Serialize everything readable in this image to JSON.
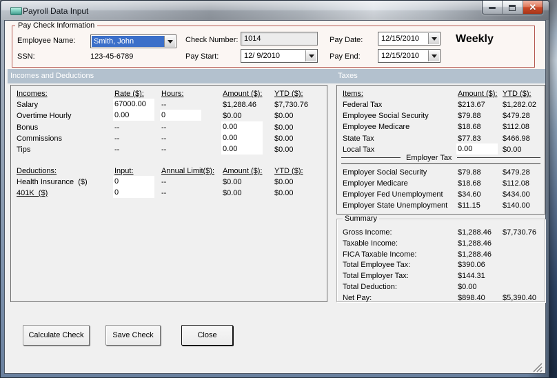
{
  "window": {
    "title": "Payroll Data Input",
    "icons": {
      "minimize": "minimize",
      "maximize": "maximize",
      "close_glyph": "✕",
      "app": "form-icon",
      "resize": "resize-grip"
    }
  },
  "paycheck": {
    "group_label": "Pay Check Information",
    "employee_name_label": "Employee Name:",
    "employee_name_value": "Smith, John",
    "ssn_label": "SSN:",
    "ssn_value": "123-45-6789",
    "check_number_label": "Check Number:",
    "check_number_value": "1014",
    "pay_start_label": "Pay Start:",
    "pay_start_value": "12/ 9/2010",
    "pay_date_label": "Pay Date:",
    "pay_date_value": "12/15/2010",
    "pay_end_label": "Pay End:",
    "pay_end_value": "12/15/2010",
    "frequency": "Weekly"
  },
  "sections": {
    "incomes": "Incomes and Deductions",
    "taxes": "Taxes"
  },
  "incomes_table": {
    "headers": [
      "Incomes:",
      "Rate ($):",
      "Hours:",
      "Amount ($):",
      "YTD ($):"
    ],
    "rows": [
      [
        {
          "t": "text",
          "v": "Salary"
        },
        {
          "t": "input",
          "v": "67000.00"
        },
        {
          "t": "text",
          "v": "--"
        },
        {
          "t": "text",
          "v": "$1,288.46"
        },
        {
          "t": "text",
          "v": "$7,730.76"
        }
      ],
      [
        {
          "t": "text",
          "v": "Overtime Hourly"
        },
        {
          "t": "input",
          "v": "0.00"
        },
        {
          "t": "input",
          "v": "0"
        },
        {
          "t": "text",
          "v": "$0.00"
        },
        {
          "t": "text",
          "v": "$0.00"
        }
      ],
      [
        {
          "t": "text",
          "v": "Bonus"
        },
        {
          "t": "text",
          "v": "--"
        },
        {
          "t": "text",
          "v": "--"
        },
        {
          "t": "input",
          "v": "0.00"
        },
        {
          "t": "text",
          "v": "$0.00"
        }
      ],
      [
        {
          "t": "text",
          "v": "Commissions"
        },
        {
          "t": "text",
          "v": "--"
        },
        {
          "t": "text",
          "v": "--"
        },
        {
          "t": "input",
          "v": "0.00"
        },
        {
          "t": "text",
          "v": "$0.00"
        }
      ],
      [
        {
          "t": "text",
          "v": "Tips"
        },
        {
          "t": "text",
          "v": "--"
        },
        {
          "t": "text",
          "v": "--"
        },
        {
          "t": "input",
          "v": "0.00"
        },
        {
          "t": "text",
          "v": "$0.00"
        }
      ]
    ]
  },
  "deductions_table": {
    "headers": [
      "Deductions:",
      "Input:",
      "Annual Limit($):",
      "Amount ($):",
      "YTD ($):"
    ],
    "rows": [
      [
        {
          "t": "text",
          "v": "Health Insurance  ($)"
        },
        {
          "t": "input",
          "v": "0"
        },
        {
          "t": "text",
          "v": "--"
        },
        {
          "t": "text",
          "v": "$0.00"
        },
        {
          "t": "text",
          "v": "$0.00"
        }
      ],
      [
        {
          "t": "link",
          "v": "401K  ($)"
        },
        {
          "t": "input",
          "v": "0"
        },
        {
          "t": "text",
          "v": "--"
        },
        {
          "t": "text",
          "v": "$0.00"
        },
        {
          "t": "text",
          "v": "$0.00"
        }
      ]
    ]
  },
  "taxes_table": {
    "headers": [
      "Items:",
      "Amount ($):",
      "YTD ($):"
    ],
    "rows": [
      [
        {
          "t": "text",
          "v": "Federal Tax"
        },
        {
          "t": "text",
          "v": "$213.67"
        },
        {
          "t": "text",
          "v": "$1,282.02"
        }
      ],
      [
        {
          "t": "text",
          "v": "Employee Social Security"
        },
        {
          "t": "text",
          "v": "$79.88"
        },
        {
          "t": "text",
          "v": "$479.28"
        }
      ],
      [
        {
          "t": "text",
          "v": "Employee Medicare"
        },
        {
          "t": "text",
          "v": "$18.68"
        },
        {
          "t": "text",
          "v": "$112.08"
        }
      ],
      [
        {
          "t": "text",
          "v": "State Tax"
        },
        {
          "t": "text",
          "v": "$77.83"
        },
        {
          "t": "text",
          "v": "$466.98"
        }
      ],
      [
        {
          "t": "text",
          "v": "Local Tax"
        },
        {
          "t": "input",
          "v": "0.00"
        },
        {
          "t": "text",
          "v": "$0.00"
        }
      ]
    ],
    "divider_label": "Employer Tax",
    "employer_rows": [
      [
        {
          "t": "text",
          "v": "Employer Social Security"
        },
        {
          "t": "text",
          "v": "$79.88"
        },
        {
          "t": "text",
          "v": "$479.28"
        }
      ],
      [
        {
          "t": "text",
          "v": "Employer Medicare"
        },
        {
          "t": "text",
          "v": "$18.68"
        },
        {
          "t": "text",
          "v": "$112.08"
        }
      ],
      [
        {
          "t": "text",
          "v": "Employer Fed Unemployment"
        },
        {
          "t": "text",
          "v": "$34.60"
        },
        {
          "t": "text",
          "v": "$434.00"
        }
      ],
      [
        {
          "t": "text",
          "v": "Employer State Unemployment"
        },
        {
          "t": "text",
          "v": "$11.15"
        },
        {
          "t": "text",
          "v": "$140.00"
        }
      ]
    ]
  },
  "summary": {
    "group_label": "Summary",
    "rows": [
      [
        "Gross Income:",
        "$1,288.46",
        "$7,730.76"
      ],
      [
        "Taxable Income:",
        "$1,288.46",
        ""
      ],
      [
        "FICA Taxable Income:",
        "$1,288.46",
        ""
      ],
      [
        "Total Employee Tax:",
        "$390.06",
        ""
      ],
      [
        "Total Employer Tax:",
        "$144.31",
        ""
      ],
      [
        "Total Deduction:",
        "$0.00",
        ""
      ],
      [
        "Net Pay:",
        "$898.40",
        "$5,390.40"
      ]
    ]
  },
  "buttons": {
    "calculate": "Calculate Check",
    "save": "Save Check",
    "close": "Close"
  }
}
